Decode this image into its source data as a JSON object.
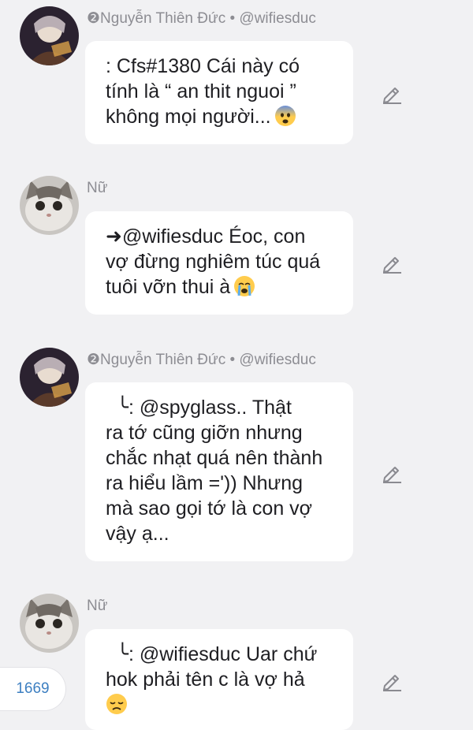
{
  "messages": [
    {
      "sender": "❷Nguyễn Thiên Đức • @wifiesduc",
      "avatar": "anime-character-avatar",
      "lines": [
        ": Cfs#1380 Cái này có",
        "tính là “ an thit nguoi ”",
        "không mọi người..."
      ],
      "emoji": "fearful-face-emoji"
    },
    {
      "sender": "Nữ",
      "avatar": "cat-avatar",
      "lines": [
        "➜@wifiesduc Éoc, con",
        "vợ đừng nghiêm túc quá",
        "tuôi vỡn thui à"
      ],
      "emoji": "crying-face-emoji"
    },
    {
      "sender": "❷Nguyễn Thiên Đức • @wifiesduc",
      "avatar": "anime-character-avatar",
      "lines": [
        "  ╰: @spyglass.. Thật",
        "ra tớ cũng giỡn nhưng",
        "chắc nhạt quá nên thành",
        "ra hiểu lầm =')) Nhưng",
        "mà sao gọi tớ là con vợ",
        "vậy ạ..."
      ],
      "emoji": ""
    },
    {
      "sender": "Nữ",
      "avatar": "cat-avatar",
      "lines": [
        "  ╰: @wifiesduc Uar chứ",
        "hok phải tên c là vợ hả",
        ""
      ],
      "emoji": "disappointed-face-emoji"
    }
  ],
  "counter": "1669",
  "colors": {
    "background": "#f1f1f3",
    "bubble": "#ffffff",
    "sender": "#8d8d93",
    "counter": "#3d7fc1"
  }
}
